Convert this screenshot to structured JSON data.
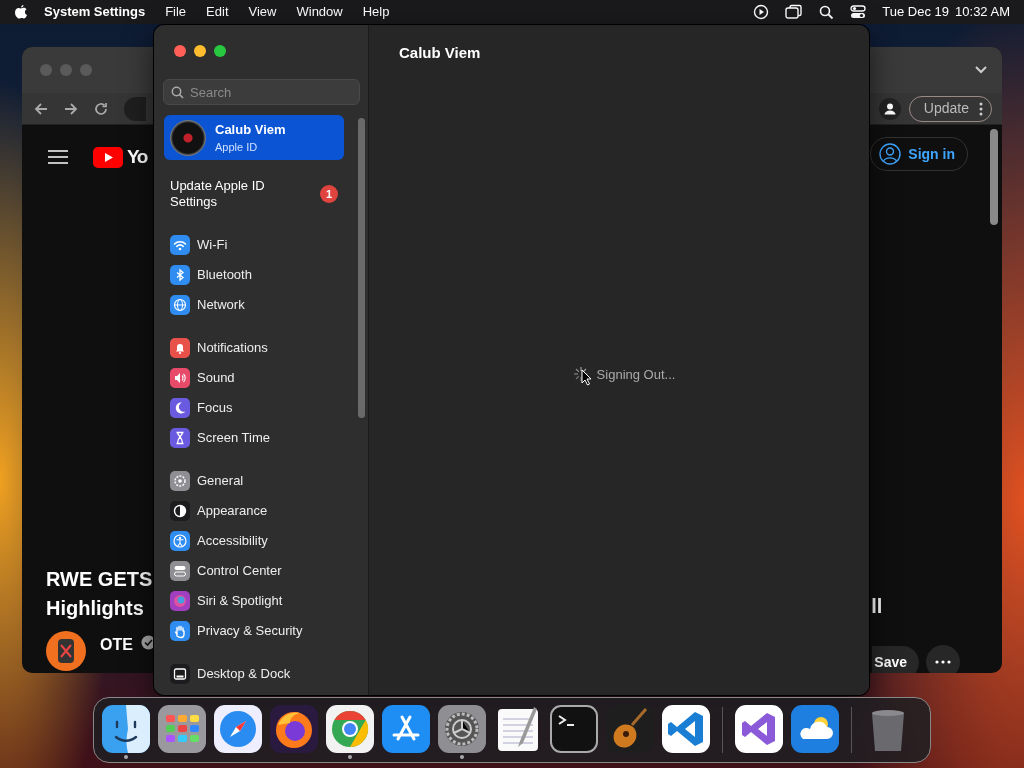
{
  "menu_bar": {
    "app": "System Settings",
    "menus": [
      "File",
      "Edit",
      "View",
      "Window",
      "Help"
    ],
    "date": "Tue Dec 19",
    "time": "10:32 AM"
  },
  "browser": {
    "logo_text": "Yo",
    "update_button": "Update",
    "sign_in": "Sign in",
    "video_title": [
      "RWE GETS",
      "Highlights"
    ],
    "title_fragment": "ll",
    "channel": "OTE",
    "save_button": "Save"
  },
  "settings": {
    "search": {
      "placeholder": "Search"
    },
    "account": {
      "name": "Calub Viem",
      "subtitle": "Apple ID",
      "selected": true
    },
    "update_row": {
      "label": "Update Apple ID Settings",
      "badge": "1"
    },
    "groups": [
      [
        {
          "label": "Wi-Fi",
          "kind": "wifi",
          "color": "#2f8cf0"
        },
        {
          "label": "Bluetooth",
          "kind": "bluetooth",
          "color": "#2f8cf0"
        },
        {
          "label": "Network",
          "kind": "globe",
          "color": "#2f8cf0"
        }
      ],
      [
        {
          "label": "Notifications",
          "kind": "bell",
          "color": "#e8504a"
        },
        {
          "label": "Sound",
          "kind": "speaker",
          "color": "#e84a6a"
        },
        {
          "label": "Focus",
          "kind": "moon",
          "color": "#6a5ae0"
        },
        {
          "label": "Screen Time",
          "kind": "hourglass",
          "color": "#6a5ae0"
        }
      ],
      [
        {
          "label": "General",
          "kind": "gear",
          "color": "#8e8e93"
        },
        {
          "label": "Appearance",
          "kind": "halfcircle",
          "color": "#1c1c1e"
        },
        {
          "label": "Accessibility",
          "kind": "person",
          "color": "#2f8cf0"
        },
        {
          "label": "Control Center",
          "kind": "toggles",
          "color": "#8e8e93"
        },
        {
          "label": "Siri & Spotlight",
          "kind": "orb",
          "color": "#a040c0"
        },
        {
          "label": "Privacy & Security",
          "kind": "hand",
          "color": "#2f8cf0"
        }
      ],
      [
        {
          "label": "Desktop & Dock",
          "kind": "dock",
          "color": "#1c1c1e"
        }
      ]
    ],
    "main": {
      "title": "Calub Viem",
      "status": "Signing Out..."
    }
  },
  "dock": {
    "apps": [
      {
        "kind": "finder",
        "running": true
      },
      {
        "kind": "launchpad",
        "running": false
      },
      {
        "kind": "safari",
        "running": false
      },
      {
        "kind": "firefox",
        "running": false
      },
      {
        "kind": "chrome",
        "running": true
      },
      {
        "kind": "appstore",
        "running": false
      },
      {
        "kind": "settings",
        "running": true
      },
      {
        "kind": "textedit",
        "running": false
      },
      {
        "kind": "terminal",
        "running": false
      },
      {
        "kind": "garageband",
        "running": false
      },
      {
        "kind": "vscode",
        "running": false
      }
    ],
    "extras": [
      {
        "kind": "visualstudio",
        "running": false
      },
      {
        "kind": "weather",
        "running": false
      }
    ],
    "trash": {
      "kind": "trash",
      "running": false
    }
  }
}
